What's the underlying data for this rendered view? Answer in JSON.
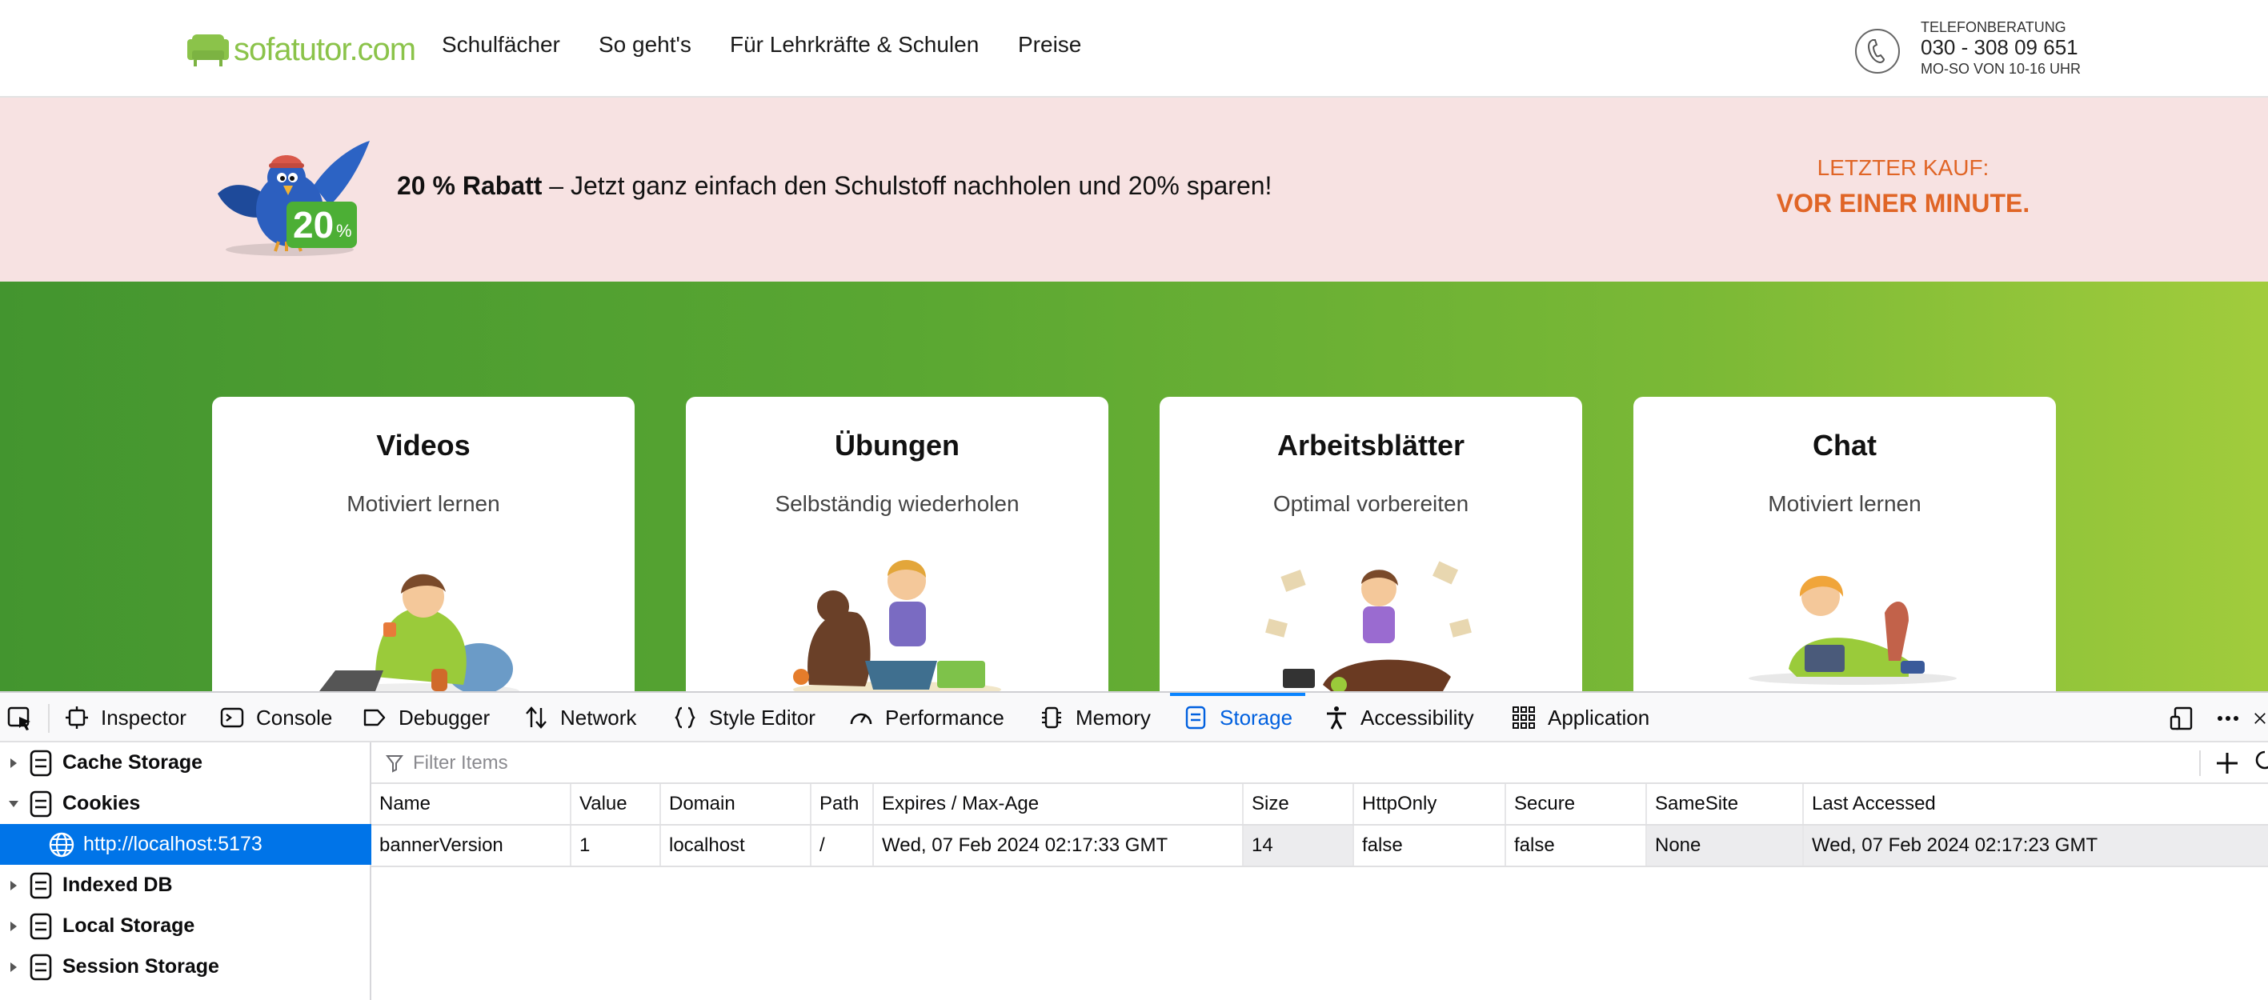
{
  "header": {
    "logo_text": "sofatutor.com",
    "nav": [
      "Schulfächer",
      "So geht's",
      "Für Lehrkräfte & Schulen",
      "Preise"
    ],
    "phone_label": "TELEFONBERATUNG",
    "phone_number": "030 - 308 09 651",
    "phone_hours": "MO-SO VON 10-16 UHR"
  },
  "promo": {
    "badge_number": "20",
    "badge_unit": "%",
    "headline_bold": "20 % Rabatt",
    "headline_rest": " – Jetzt ganz einfach den Schulstoff nachholen und 20% sparen!",
    "last_purchase_label": "LETZTER KAUF:",
    "last_purchase_value": "VOR EINER MINUTE."
  },
  "features": [
    {
      "title": "Videos",
      "subtitle": "Motiviert lernen"
    },
    {
      "title": "Übungen",
      "subtitle": "Selbständig wiederholen"
    },
    {
      "title": "Arbeitsblätter",
      "subtitle": "Optimal vorbereiten"
    },
    {
      "title": "Chat",
      "subtitle": "Motiviert lernen"
    }
  ],
  "devtools": {
    "tabs": [
      "Inspector",
      "Console",
      "Debugger",
      "Network",
      "Style Editor",
      "Performance",
      "Memory",
      "Storage",
      "Accessibility",
      "Application"
    ],
    "active_tab": "Storage",
    "tree": {
      "cache_storage": "Cache Storage",
      "cookies": "Cookies",
      "cookie_host": "http://localhost:5173",
      "indexed_db": "Indexed DB",
      "local_storage": "Local Storage",
      "session_storage": "Session Storage"
    },
    "filter_placeholder": "Filter Items",
    "columns": [
      "Name",
      "Value",
      "Domain",
      "Path",
      "Expires / Max-Age",
      "Size",
      "HttpOnly",
      "Secure",
      "SameSite",
      "Last Accessed"
    ],
    "rows": [
      [
        "bannerVersion",
        "1",
        "localhost",
        "/",
        "Wed, 07 Feb 2024 02:17:33 GMT",
        "14",
        "false",
        "false",
        "None",
        "Wed, 07 Feb 2024 02:17:23 GMT"
      ]
    ]
  },
  "colors": {
    "brand_green": "#8bc34a",
    "promo_background": "#f7e2e2",
    "accent_orange": "#e06526",
    "devtools_selected": "#0074e8",
    "devtools_active_tab": "#0060df"
  }
}
